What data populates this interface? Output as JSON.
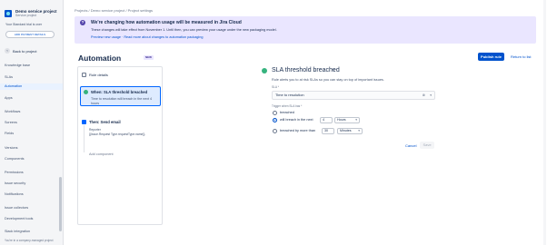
{
  "sidebar": {
    "project_name": "Demo service project",
    "project_type": "Service project",
    "trial_text": "Your Standard trial is over",
    "payment_button": "ADD PAYMENT DETAILS",
    "back_label": "Back to project",
    "items": [
      {
        "label": "Knowledge base"
      },
      {
        "label": "SLAs"
      },
      {
        "label": "Automation"
      },
      {
        "label": "Apps"
      },
      {
        "label": "Workflows"
      },
      {
        "label": "Screens"
      },
      {
        "label": "Fields"
      },
      {
        "label": "Versions"
      },
      {
        "label": "Components"
      },
      {
        "label": "Permissions"
      },
      {
        "label": "Issue security"
      },
      {
        "label": "Notifications"
      },
      {
        "label": "Issue collectors"
      },
      {
        "label": "Development tools"
      },
      {
        "label": "Slack integration"
      }
    ],
    "footer": "You're in a company-managed project"
  },
  "breadcrumb": "Projects  /  Demo service project  /  Project settings",
  "banner": {
    "title": "We're changing how automation usage will be measured in Jira Cloud",
    "body": "These changes will take effect from November 1. Until then, you can preview your usage under the new packaging model.",
    "link1": "Preview new usage",
    "sep": " · ",
    "link2": "Read more about changes to automation packaging"
  },
  "page": {
    "title": "Automation",
    "badge": "NEW",
    "publish_label": "Publish rule",
    "return_label": "Return to list"
  },
  "rule": {
    "details_label": "Rule details",
    "trigger_title": "When: SLA threshold breached",
    "trigger_desc": "Time to resolution will breach in the next 4 hours",
    "action_title": "Then: Send email",
    "action_sub": "Reporter",
    "action_value": "{{issue.Request Type.requestType.name}}",
    "add_component": "Add component"
  },
  "config": {
    "title": "SLA threshold breached",
    "desc": "Rule alerts you to at risk SLAs so you can stay on top of important issues.",
    "sla_label": "SLA *",
    "sla_value": "Time to resolution",
    "trigger_label": "Trigger when SLA has *",
    "opt1": "breached",
    "opt2": "will breach in the next",
    "opt2_num": "4",
    "opt2_unit": "Hours",
    "opt3": "breached by more than",
    "opt3_num": "30",
    "opt3_unit": "Minutes",
    "cancel_label": "Cancel",
    "save_label": "Save"
  },
  "colors": {
    "primary": "#0052cc",
    "banner": "#eae6ff",
    "trigger": "#36b37e"
  }
}
